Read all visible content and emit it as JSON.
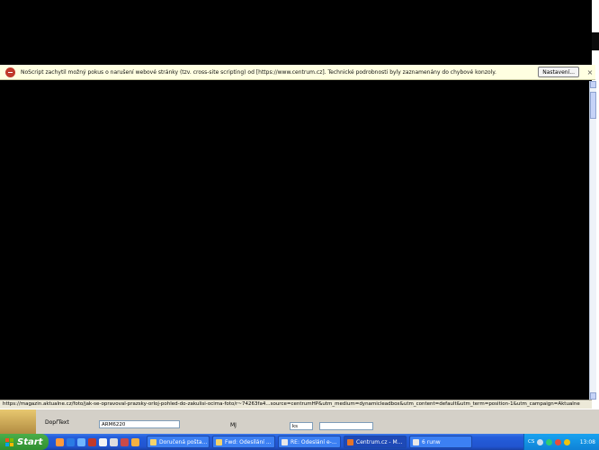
{
  "noscript": {
    "message": "NoScript zachytil možný pokus o narušení webové stránky (tzv. cross-site scripting) od [https://www.centrum.cz]. Technické podrobnosti byly zaznamenány do chybové konzoly.",
    "settings_label": "Nastavení...",
    "close_label": "×"
  },
  "status": {
    "url": "https://magazin.aktualne.cz/foto/jak-se-opravoval-prazsky-orloj-pohled-do-zakulisi-ocima-foto/r~74263fa4...source=centrumHP&utm_medium=dynamicleadbox&utm_content=default&utm_term=position-1&utm_campaign=Aktualne"
  },
  "behind": {
    "label1": "DopřText",
    "field1": "ARM6220",
    "label2": "MJ",
    "field2": "ks"
  },
  "taskbar": {
    "start_label": "Start",
    "tasks": [
      {
        "label": "Doručená pošta...",
        "color": "#f5d36a"
      },
      {
        "label": "Fwd: Odesílání ...",
        "color": "#f5d36a"
      },
      {
        "label": "RE: Odeslání e-...",
        "color": "#e8e8e8"
      },
      {
        "label": "Centrum.cz - M...",
        "color": "#e4742a"
      },
      {
        "label": "6 runw",
        "color": "#e8e8e8"
      }
    ],
    "tray_label": "CS",
    "clock": "13:08"
  }
}
